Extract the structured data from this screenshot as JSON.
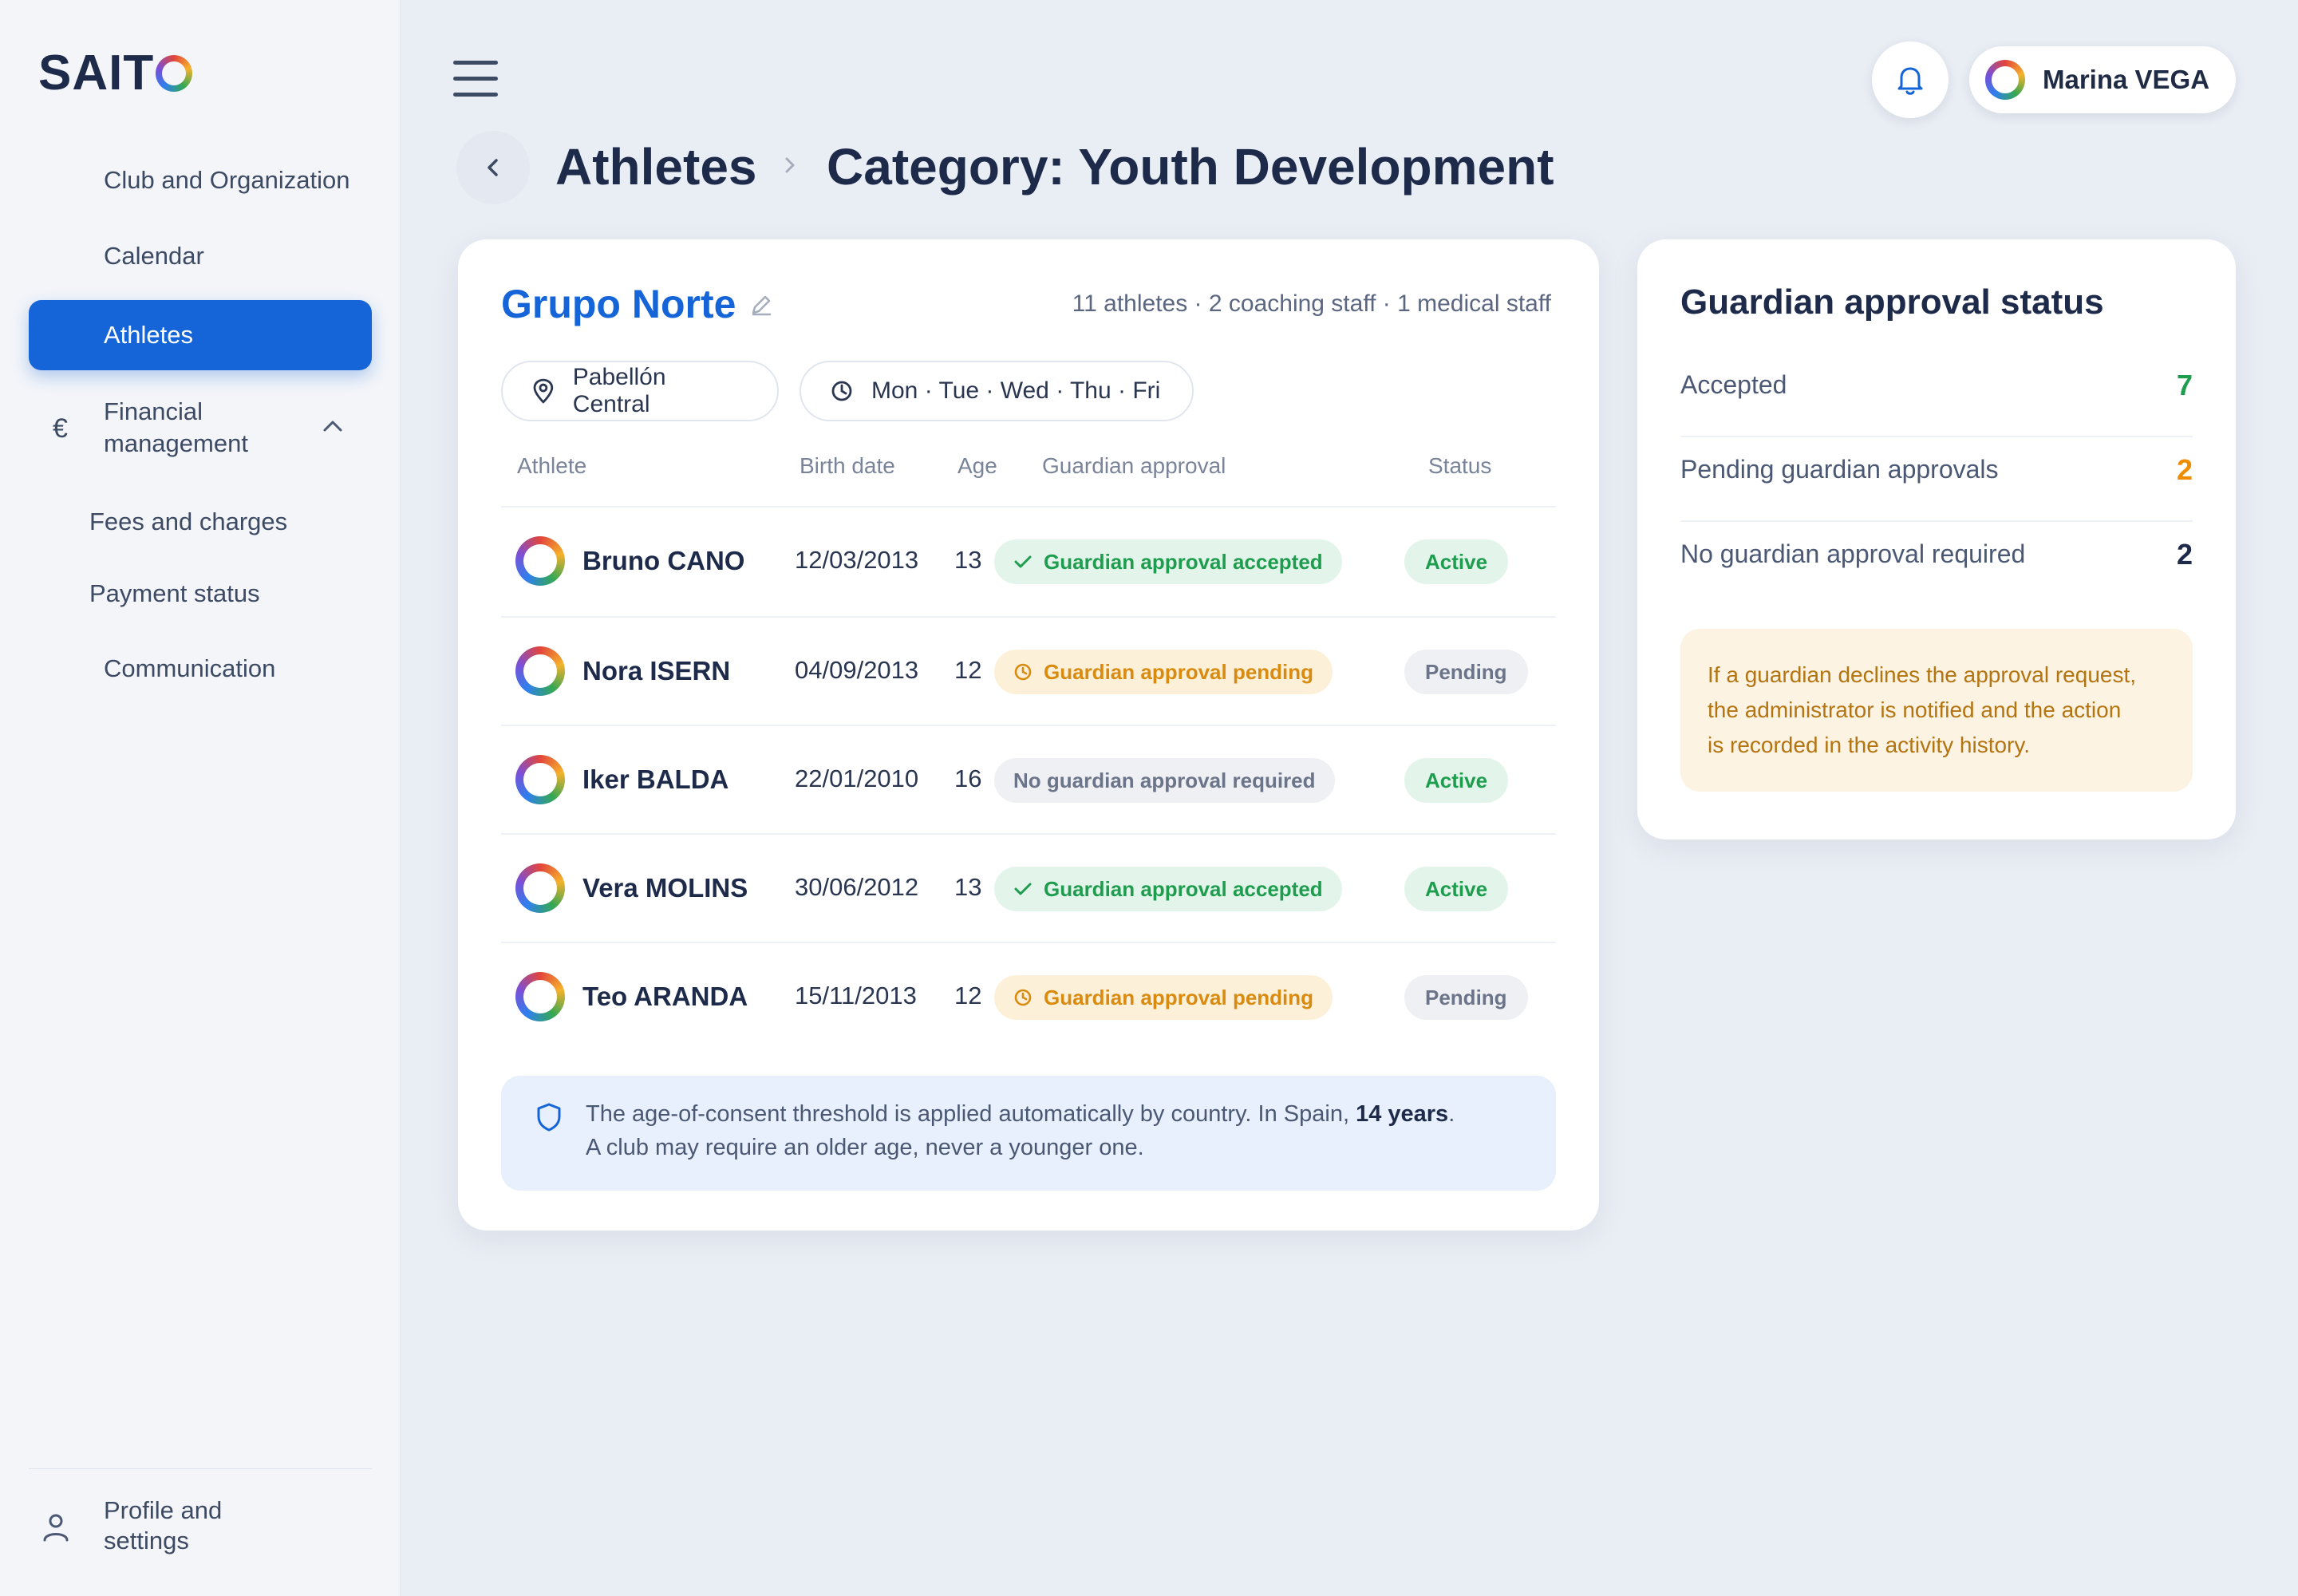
{
  "brand": {
    "logo_text": "SAITO"
  },
  "sidebar": {
    "items": [
      {
        "label": "Club and Organization"
      },
      {
        "label": "Calendar"
      },
      {
        "label": "Athletes",
        "active": true
      },
      {
        "label_line1": "Financial",
        "label_line2": "management",
        "icon": "euro-icon",
        "expanded": true
      },
      {
        "label": "Fees and charges"
      },
      {
        "label": "Payment status"
      },
      {
        "label": "Communication"
      }
    ],
    "profile": {
      "label_line1": "Profile and",
      "label_line2": "settings",
      "icon": "person-icon"
    }
  },
  "topbar": {
    "menu_icon": "hamburger-icon",
    "notification_icon": "bell-icon",
    "user_name": "Marina VEGA"
  },
  "breadcrumb": {
    "root": "Athletes",
    "current": "Category: Youth Development"
  },
  "group": {
    "name": "Grupo Norte",
    "meta": "11 athletes · 2 coaching staff · 1 medical staff",
    "location": "Pabellón Central",
    "schedule": "Mon · Tue · Wed · Thu · Fri"
  },
  "table": {
    "headers": [
      "Athlete",
      "Birth date",
      "Age",
      "Guardian approval",
      "Status"
    ],
    "rows": [
      {
        "name": "Bruno CANO",
        "birth": "12/03/2013",
        "age": "13",
        "approval": "Guardian approval accepted",
        "approval_kind": "accepted",
        "status": "Active"
      },
      {
        "name": "Nora ISERN",
        "birth": "04/09/2013",
        "age": "12",
        "approval": "Guardian approval pending",
        "approval_kind": "pending",
        "status": "Pending"
      },
      {
        "name": "Iker BALDA",
        "birth": "22/01/2010",
        "age": "16",
        "approval": "No guardian approval required",
        "approval_kind": "none",
        "status": "Active"
      },
      {
        "name": "Vera MOLINS",
        "birth": "30/06/2012",
        "age": "13",
        "approval": "Guardian approval accepted",
        "approval_kind": "accepted",
        "status": "Active"
      },
      {
        "name": "Teo ARANDA",
        "birth": "15/11/2013",
        "age": "12",
        "approval": "Guardian approval pending",
        "approval_kind": "pending",
        "status": "Pending"
      }
    ]
  },
  "notice": {
    "line1_prefix": "The age-of-consent threshold is applied automatically by country. In Spain, ",
    "line1_bold": "14 years",
    "line1_suffix": ".",
    "line2": "A club may require an older age, never a younger one."
  },
  "approval_status": {
    "title": "Guardian approval status",
    "stats": [
      {
        "label": "Accepted",
        "value": "7",
        "color": "#1f9d4f"
      },
      {
        "label": "Pending guardian approvals",
        "value": "2",
        "color": "#f08c00"
      },
      {
        "label": "No guardian approval required",
        "value": "2",
        "color": "#1d2a4a"
      }
    ],
    "warning_lines": [
      "If a guardian declines the approval request,",
      "the administrator is notified and the action",
      "is recorded in the activity history."
    ]
  },
  "colors": {
    "accent": "#1565d8",
    "success": "#1f9d4f",
    "warning": "#f08c00"
  }
}
